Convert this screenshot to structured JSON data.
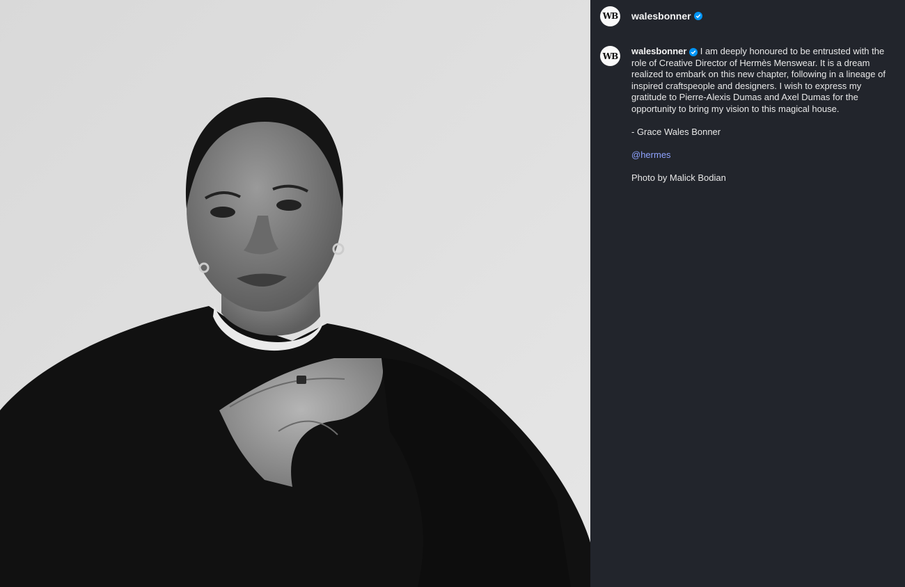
{
  "post": {
    "username": "walesbonner",
    "avatar_text": "WB",
    "verified": true,
    "photo_alt": "Black and white portrait of a woman in a dark sweater with hands crossed at chest"
  },
  "caption": {
    "username": "walesbonner",
    "body": "I am deeply honoured to be entrusted with the role of Creative Director of Hermès Menswear. It is a dream realized to embark on this new chapter, following in a lineage of inspired craftspeople and designers. I wish to express my gratitude to Pierre-Alexis Dumas and Axel Dumas for the opportunity to bring my vision to this magical house.",
    "signature": "- Grace Wales Bonner",
    "mention": "@hermes",
    "credit": "Photo by Malick Bodian"
  },
  "colors": {
    "panel_bg": "#22252c",
    "verified": "#0095f6",
    "mention": "#8fa3ff"
  }
}
